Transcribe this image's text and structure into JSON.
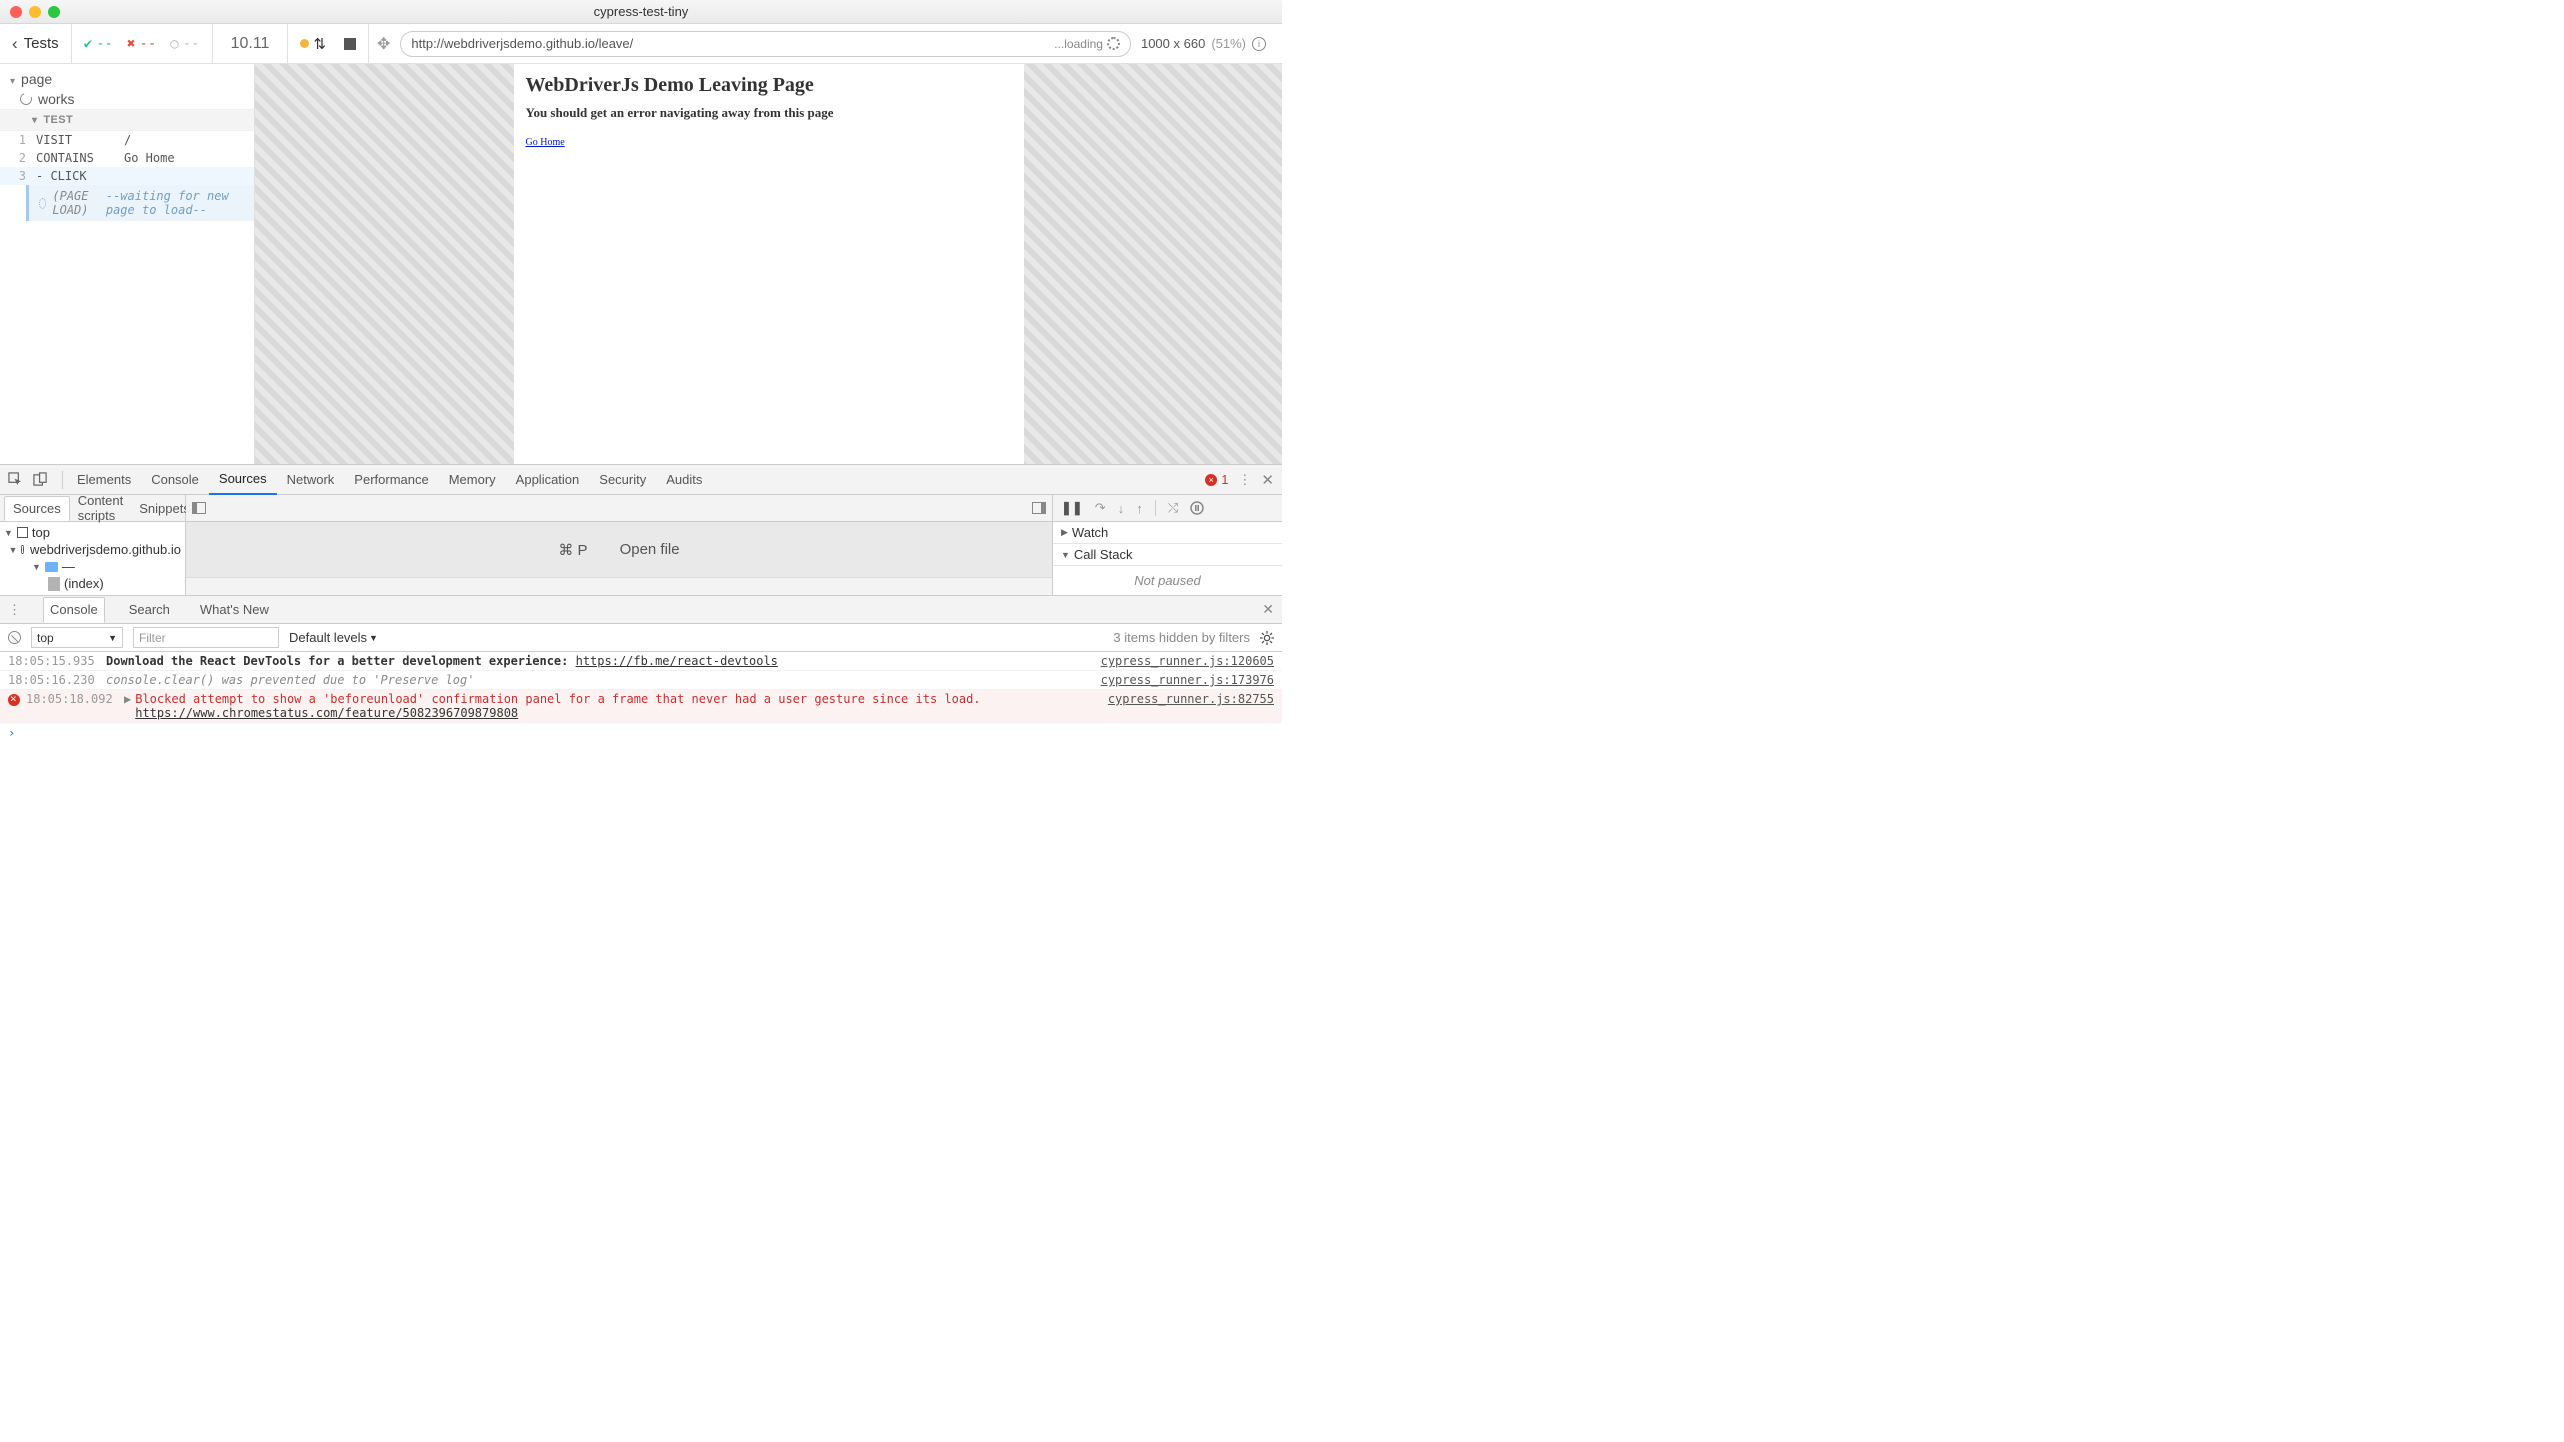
{
  "window": {
    "title": "cypress-test-tiny"
  },
  "runner": {
    "back_label": "Tests",
    "stats": {
      "pass": "--",
      "fail": "--",
      "pending": "--"
    },
    "time": "10.11",
    "url": "http://webdriverjsdemo.github.io/leave/",
    "loading_label": "...loading",
    "viewport": "1000 x 660",
    "viewport_pct": "(51%)"
  },
  "reporter": {
    "suite": "page",
    "test": "works",
    "section": "TEST",
    "commands": [
      {
        "n": "1",
        "name": "VISIT",
        "msg": "/"
      },
      {
        "n": "2",
        "name": "CONTAINS",
        "msg": "Go Home"
      },
      {
        "n": "3",
        "name": "- CLICK",
        "msg": ""
      }
    ],
    "page_load_label": "(PAGE LOAD)",
    "page_load_msg": "--waiting for new page to load--"
  },
  "aut": {
    "h1": "WebDriverJs Demo Leaving Page",
    "h3": "You should get an error navigating away from this page",
    "link": "Go Home"
  },
  "devtools": {
    "tabs": [
      "Elements",
      "Console",
      "Sources",
      "Network",
      "Performance",
      "Memory",
      "Application",
      "Security",
      "Audits"
    ],
    "active_tab": "Sources",
    "error_count": "1",
    "sources": {
      "nav_tabs": [
        "Sources",
        "Content scripts",
        "Snippets"
      ],
      "tree": {
        "top": "top",
        "domain": "webdriverjsdemo.github.io",
        "folder": "—",
        "file": "(index)"
      },
      "open_file_shortcut": "⌘ P",
      "open_file_label": "Open file"
    },
    "debugger": {
      "sections": [
        "Watch",
        "Call Stack"
      ],
      "not_paused": "Not paused"
    },
    "drawer_tabs": [
      "Console",
      "Search",
      "What's New"
    ],
    "console": {
      "context": "top",
      "filter_placeholder": "Filter",
      "levels_label": "Default levels",
      "hidden_msg": "3 items hidden by filters",
      "messages": [
        {
          "ts": "18:05:15.935",
          "kind": "log",
          "body": "Download the React DevTools for a better development experience:",
          "link": "https://fb.me/react-devtools",
          "src": "cypress_runner.js:120605"
        },
        {
          "ts": "18:05:16.230",
          "kind": "info",
          "body": "console.clear() was prevented due to 'Preserve log'",
          "src": "cypress_runner.js:173976"
        },
        {
          "ts": "18:05:18.092",
          "kind": "error",
          "body": "Blocked attempt to show a 'beforeunload' confirmation panel for a frame that never had a user gesture since its load.",
          "link": "https://www.chromestatus.com/feature/5082396709879808",
          "src": "cypress_runner.js:82755"
        }
      ]
    }
  }
}
